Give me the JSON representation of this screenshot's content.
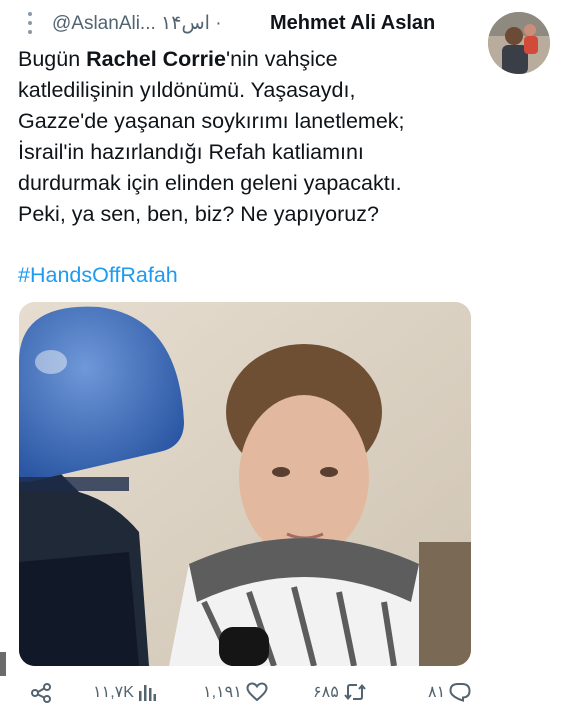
{
  "header": {
    "more_icon": "vertical-ellipsis-icon",
    "handle": "@AslanAli... ۱۴اس ·",
    "display_name": "Mehmet Ali Aslan"
  },
  "tweet": {
    "line1_pre": "Bugün ",
    "line1_bold": "Rachel Corrie",
    "line1_post": "'nin vahşice",
    "line2": "katledilişinin yıldönümü. Yaşasaydı,",
    "line3": "Gazze'de yaşanan soykırımı lanetlemek;",
    "line4": "İsrail'in hazırlandığı Refah katliamını",
    "line5": "durdurmak için elinden geleni yapacaktı.",
    "line6": "Peki, ya sen, ben, biz? Ne yapıyoruz?",
    "hashtag": "#HandsOffRafah"
  },
  "actions": {
    "share_icon": "share-icon",
    "views": "۱۱,۷K",
    "views_icon": "bar-chart-icon",
    "likes": "۱,۱۹۱",
    "likes_icon": "heart-icon",
    "retweets": "۶۸۵",
    "retweets_icon": "retweet-icon",
    "replies": "۸۱",
    "replies_icon": "reply-bubble-icon"
  },
  "colors": {
    "text": "#0f1419",
    "secondary": "#536471",
    "link": "#1d9bf0"
  }
}
